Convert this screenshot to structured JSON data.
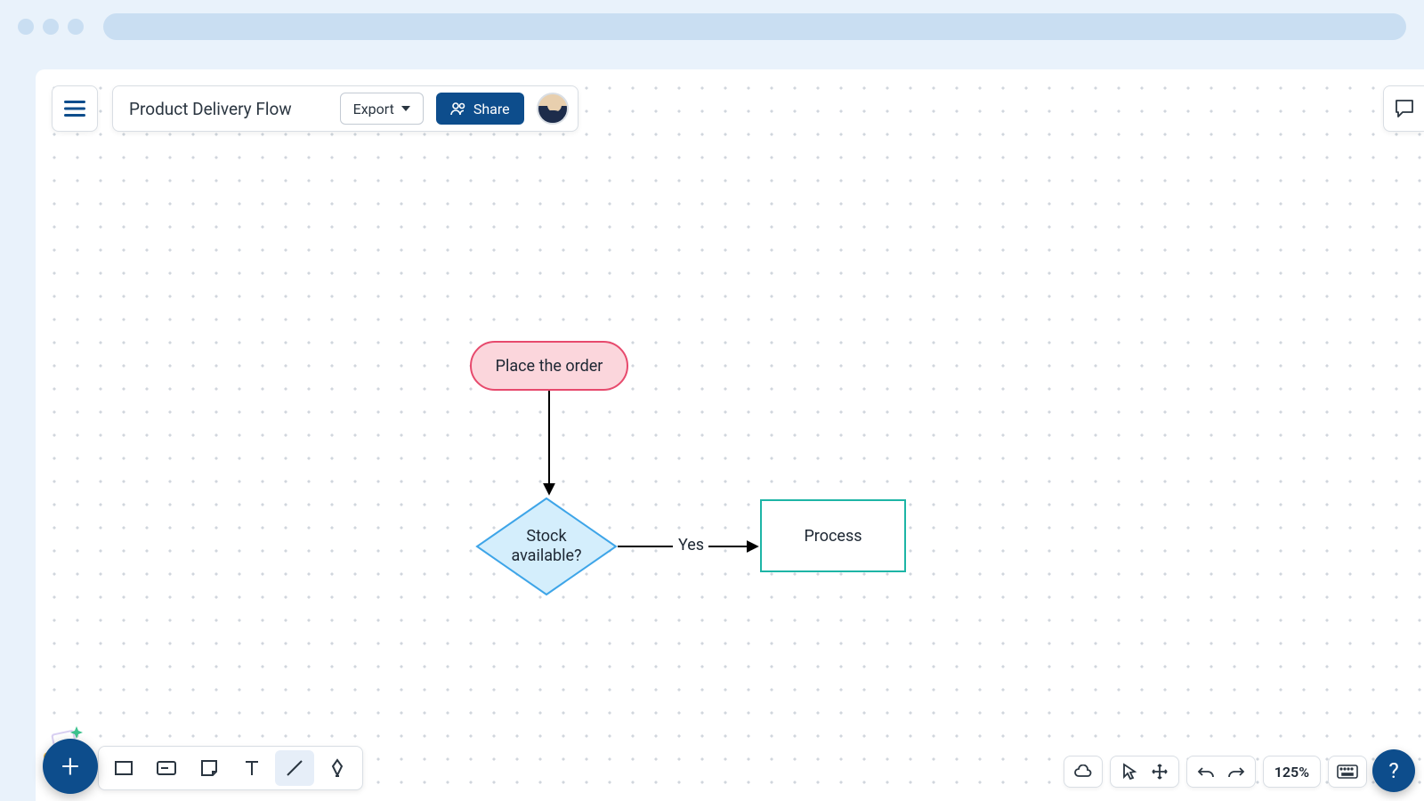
{
  "header": {
    "doc_title": "Product Delivery Flow",
    "export_label": "Export",
    "share_label": "Share"
  },
  "nodes": {
    "start": {
      "label": "Place the order"
    },
    "decision": {
      "label_line1": "Stock",
      "label_line2": "available?"
    },
    "process": {
      "label": "Process"
    }
  },
  "edges": {
    "decision_to_process": "Yes"
  },
  "view": {
    "zoom": "125%"
  },
  "colors": {
    "primary": "#0d4d8c",
    "terminator_stroke": "#e74a6d",
    "terminator_fill": "#fbd6dc",
    "decision_stroke": "#3ea5e8",
    "decision_fill": "#d4eefc",
    "process_stroke": "#1db5a6"
  }
}
